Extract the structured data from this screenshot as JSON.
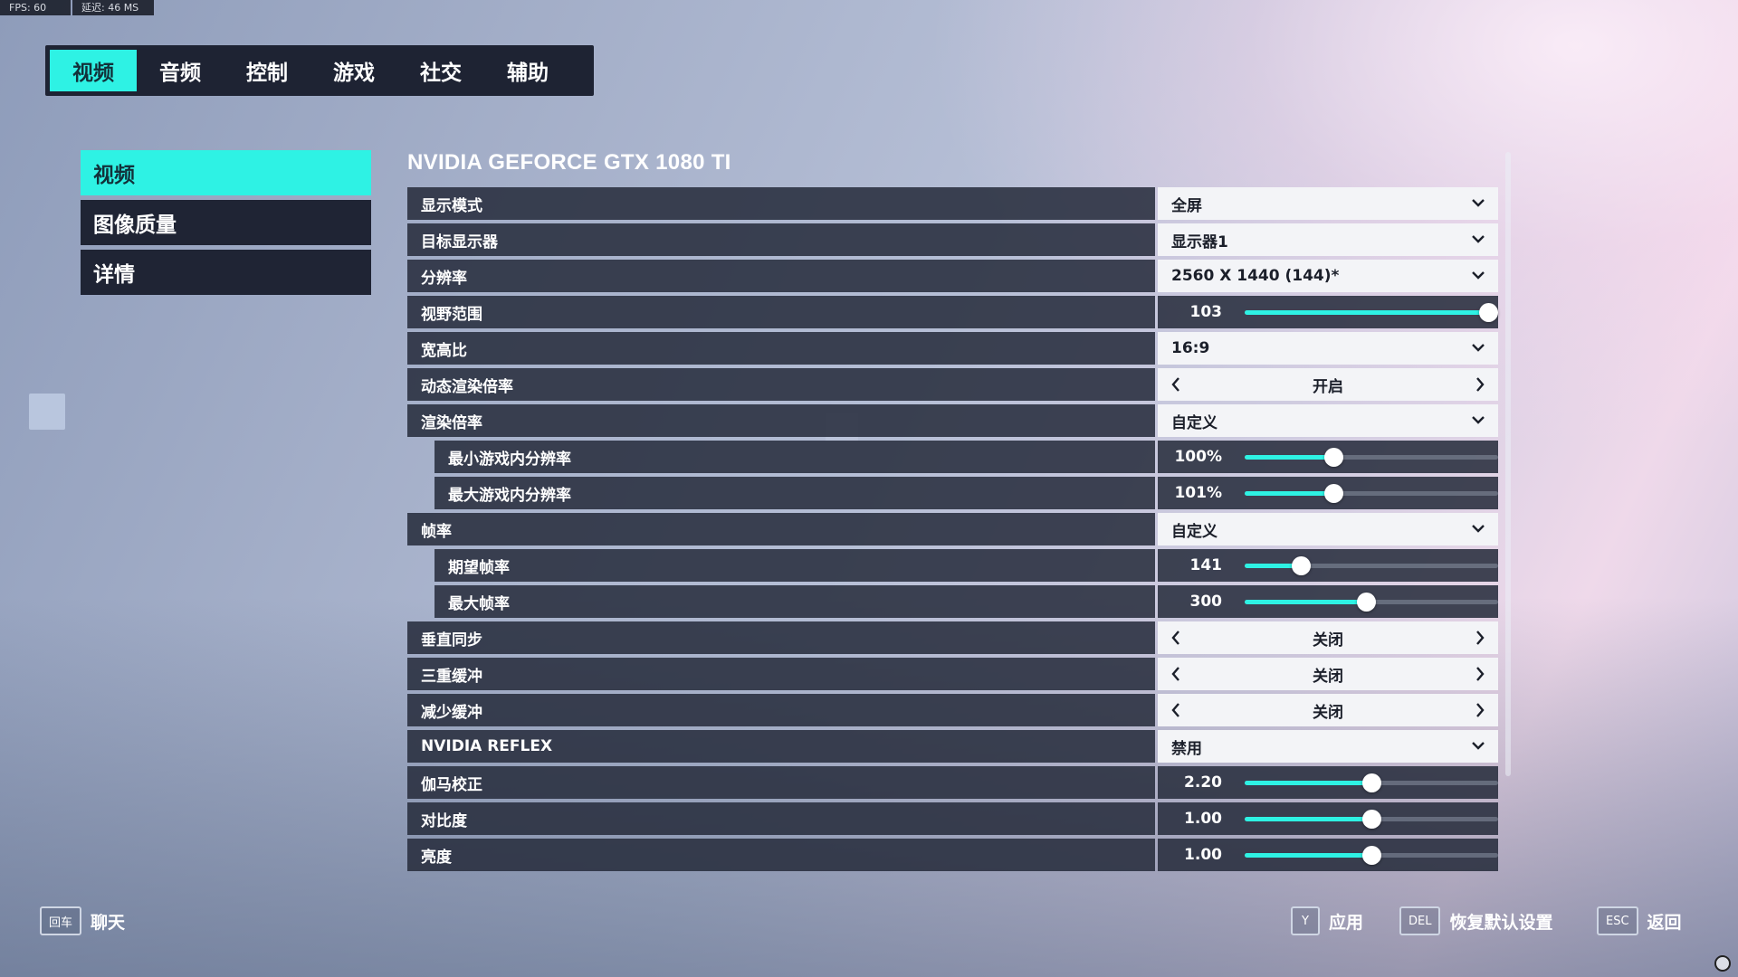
{
  "perf": {
    "fps": "FPS:  60",
    "latency": "延迟:  46 MS"
  },
  "tabs": [
    {
      "label": "视频",
      "active": true
    },
    {
      "label": "音频"
    },
    {
      "label": "控制"
    },
    {
      "label": "游戏"
    },
    {
      "label": "社交"
    },
    {
      "label": "辅助"
    }
  ],
  "side_menu": [
    {
      "label": "视频",
      "active": true
    },
    {
      "label": "图像质量"
    },
    {
      "label": "详情"
    }
  ],
  "gpu_title": "NVIDIA GEFORCE GTX 1080 TI",
  "settings": [
    {
      "label": "显示模式",
      "type": "dropdown",
      "value": "全屏"
    },
    {
      "label": "目标显示器",
      "type": "dropdown",
      "value": "显示器1"
    },
    {
      "label": "分辨率",
      "type": "dropdown",
      "value": "2560 X 1440 (144)*"
    },
    {
      "label": "视野范围",
      "type": "slider",
      "value": "103",
      "level": 0.96
    },
    {
      "label": "宽高比",
      "type": "dropdown",
      "value": "16:9"
    },
    {
      "label": "动态渲染倍率",
      "type": "toggle",
      "value": "开启"
    },
    {
      "label": "渲染倍率",
      "type": "dropdown",
      "value": "自定义"
    },
    {
      "label": "最小游戏内分辨率",
      "type": "slider",
      "value": "100%",
      "level": 0.35,
      "sub": true
    },
    {
      "label": "最大游戏内分辨率",
      "type": "slider",
      "value": "101%",
      "level": 0.35,
      "sub": true
    },
    {
      "label": "帧率",
      "type": "dropdown",
      "value": "自定义"
    },
    {
      "label": "期望帧率",
      "type": "slider",
      "value": "141",
      "level": 0.22,
      "sub": true
    },
    {
      "label": "最大帧率",
      "type": "slider",
      "value": "300",
      "level": 0.48,
      "sub": true
    },
    {
      "label": "垂直同步",
      "type": "toggle",
      "value": "关闭"
    },
    {
      "label": "三重缓冲",
      "type": "toggle",
      "value": "关闭"
    },
    {
      "label": "减少缓冲",
      "type": "toggle",
      "value": "关闭"
    },
    {
      "label": "NVIDIA REFLEX",
      "type": "dropdown",
      "value": "禁用"
    },
    {
      "label": "伽马校正",
      "type": "slider",
      "value": "2.20",
      "level": 0.5
    },
    {
      "label": "对比度",
      "type": "slider",
      "value": "1.00",
      "level": 0.5
    },
    {
      "label": "亮度",
      "type": "slider",
      "value": "1.00",
      "level": 0.5
    }
  ],
  "hints": {
    "chat": {
      "key": "回车",
      "label": "聊天"
    },
    "apply": {
      "key": "Y",
      "label": "应用"
    },
    "reset": {
      "key": "DEL",
      "label": "恢复默认设置"
    },
    "back": {
      "key": "ESC",
      "label": "返回"
    }
  },
  "colors": {
    "accent": "#2ef2e4",
    "panel": "#282e3e",
    "control_bg": "#f3f4f7"
  }
}
